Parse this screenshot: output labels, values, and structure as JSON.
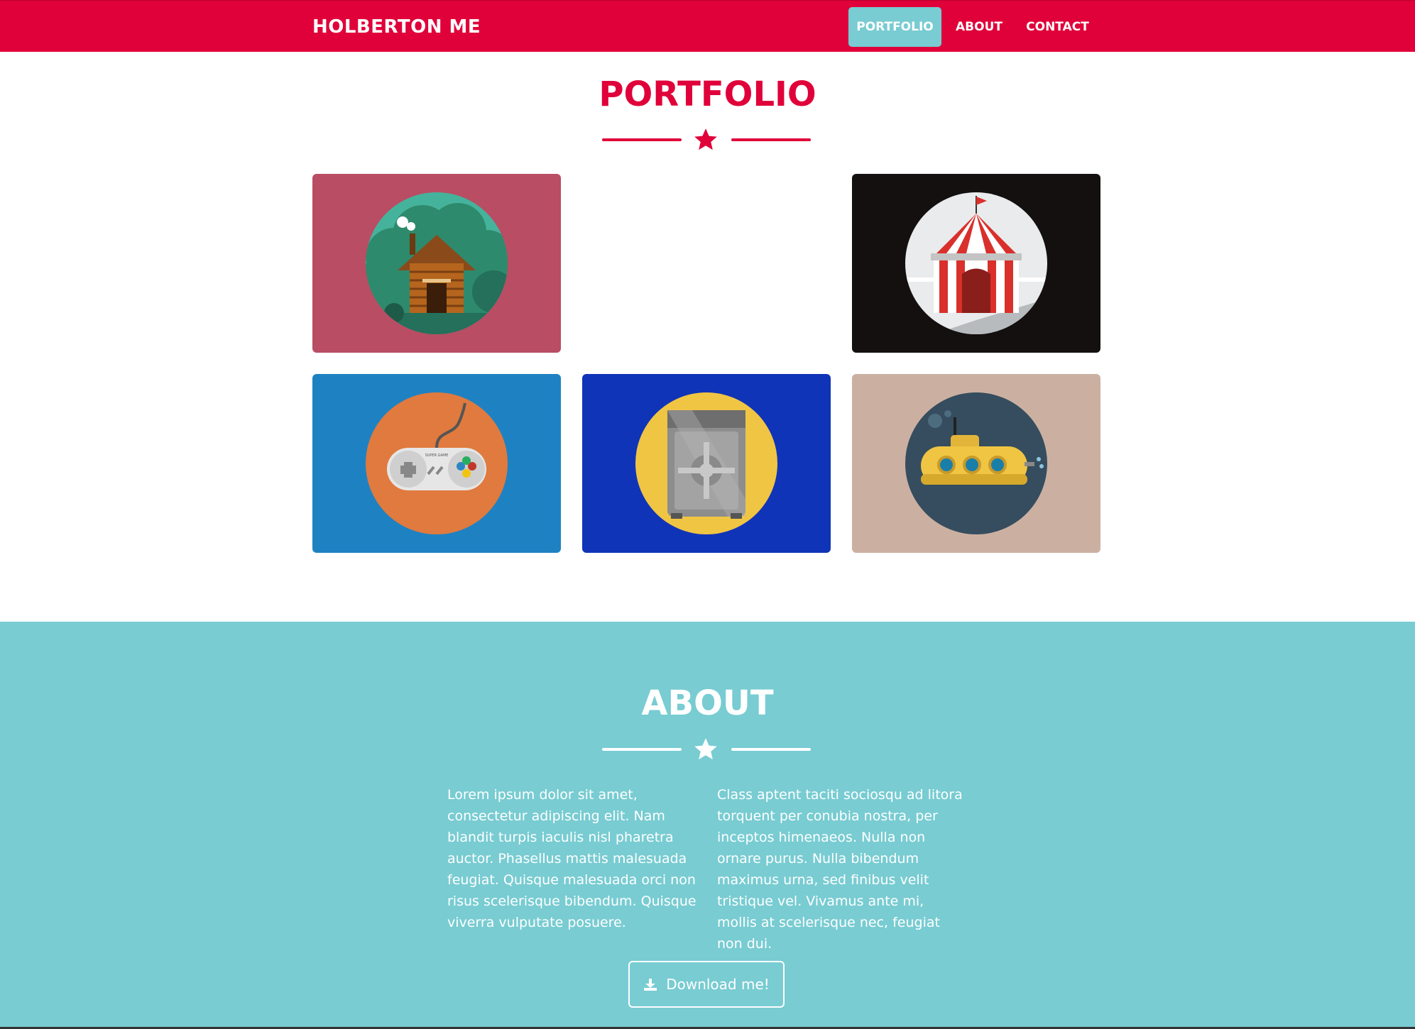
{
  "navbar": {
    "brand": "HOLBERTON ME",
    "items": [
      {
        "label": "PORTFOLIO",
        "active": true
      },
      {
        "label": "ABOUT",
        "active": false
      },
      {
        "label": "CONTACT",
        "active": false
      }
    ]
  },
  "portfolio": {
    "title": "PORTFOLIO",
    "tiles": [
      {
        "icon": "log-cabin-icon",
        "bg": "#b84d64"
      },
      {
        "icon": "circus-tent-icon",
        "bg": "#141010"
      },
      {
        "icon": "game-controller-icon",
        "bg": "#1e82c2",
        "label": "SUPER GAME"
      },
      {
        "icon": "safe-icon",
        "bg": "#1034b8"
      },
      {
        "icon": "submarine-icon",
        "bg": "#cbb0a2"
      }
    ]
  },
  "about": {
    "title": "ABOUT",
    "left_text": "Lorem ipsum dolor sit amet, consectetur adipiscing elit. Nam blandit turpis iaculis nisl pharetra auctor. Phasellus mattis malesuada feugiat. Quisque malesuada orci non risus scelerisque bibendum. Quisque viverra vulputate posuere.",
    "right_text": "Class aptent taciti sociosqu ad litora torquent per conubia nostra, per inceptos himenaeos. Nulla non ornare purus. Nulla bibendum maximus urna, sed finibus velit tristique vel. Vivamus ante mi, mollis at scelerisque nec, feugiat non dui.",
    "button_label": "Download me!"
  },
  "colors": {
    "primary": "#e0003a",
    "accent": "#78ccd2",
    "white": "#ffffff"
  }
}
